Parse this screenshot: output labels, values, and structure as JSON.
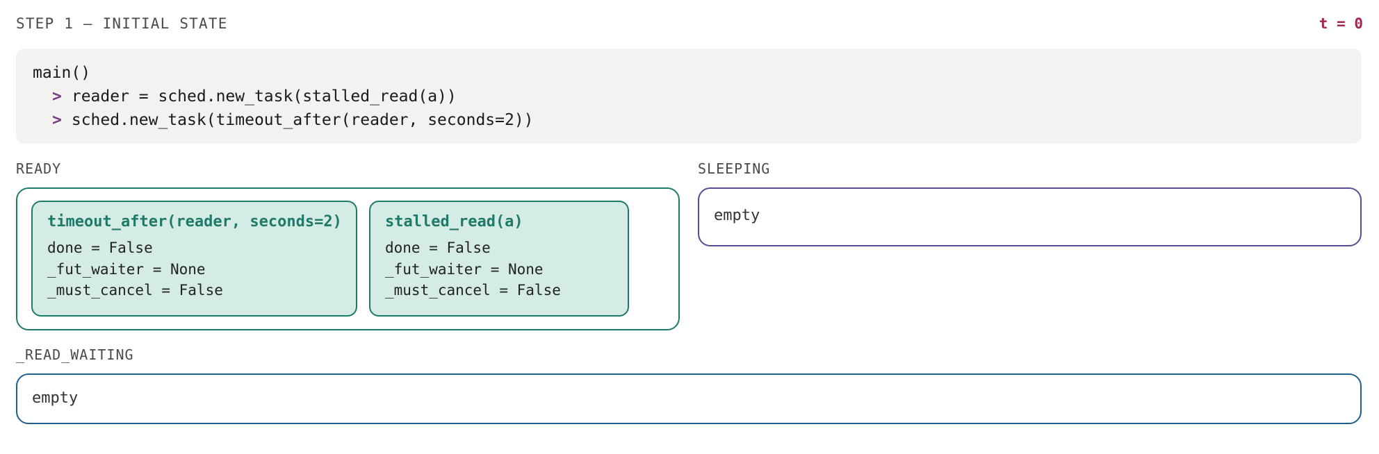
{
  "header": {
    "step_title": "STEP 1 — INITIAL STATE",
    "time_label": "t = 0"
  },
  "code": {
    "prompt_glyph": ">",
    "lines": [
      "main()",
      "reader = sched.new_task(stalled_read(a))",
      "sched.new_task(timeout_after(reader, seconds=2))"
    ]
  },
  "queues": {
    "ready": {
      "label": "READY",
      "tasks": [
        {
          "name": "timeout_after(reader, seconds=2)",
          "fields": [
            "done = False",
            "_fut_waiter = None",
            "_must_cancel = False"
          ]
        },
        {
          "name": "stalled_read(a)",
          "fields": [
            "done = False",
            "_fut_waiter = None",
            "_must_cancel = False"
          ]
        }
      ]
    },
    "sleeping": {
      "label": "SLEEPING",
      "empty_text": "empty"
    },
    "read_waiting": {
      "label": "_READ_WAITING",
      "empty_text": "empty"
    }
  },
  "colors": {
    "ready_border": "#1e7a68",
    "task_fill": "#d4ece5",
    "sleeping_border": "#5a4a96",
    "read_waiting_border": "#1f5f8f",
    "time_accent": "#a3264f",
    "prompt_accent": "#7b3a87"
  }
}
